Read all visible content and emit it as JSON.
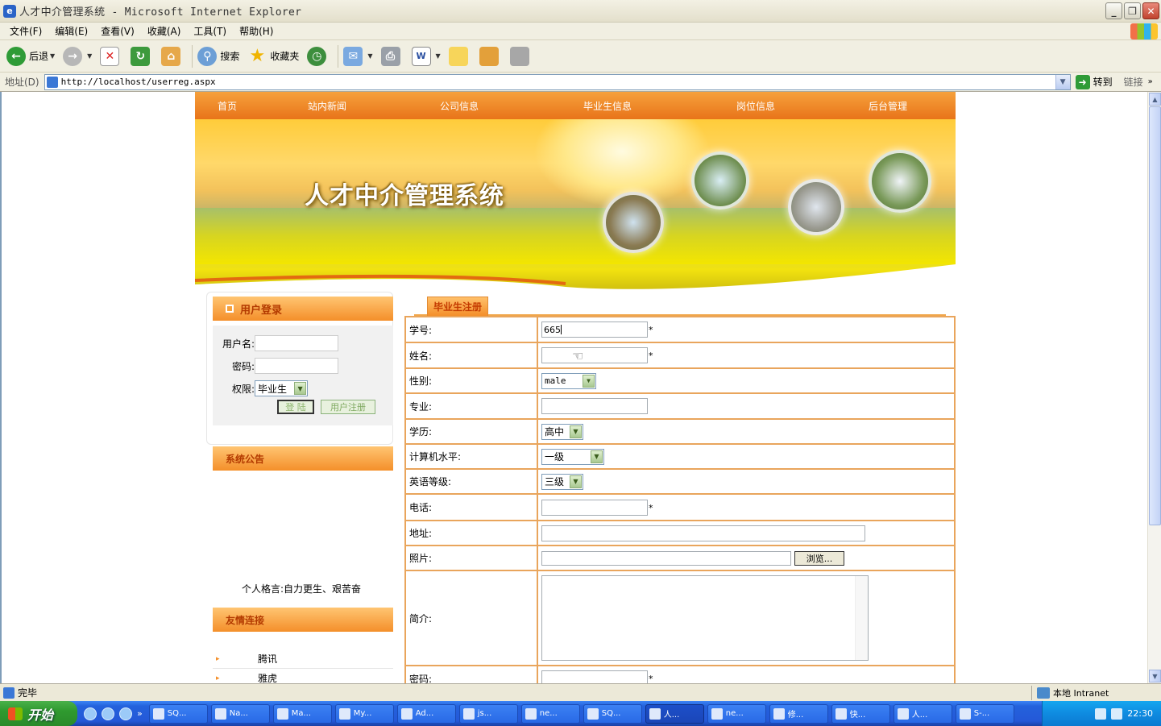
{
  "window": {
    "title": "人才中介管理系统 - Microsoft Internet Explorer"
  },
  "menu": [
    "文件(F)",
    "编辑(E)",
    "查看(V)",
    "收藏(A)",
    "工具(T)",
    "帮助(H)"
  ],
  "toolbar": {
    "back_label": "后退",
    "search_label": "搜索",
    "favorites_label": "收藏夹"
  },
  "address": {
    "label": "地址(D)",
    "url": "http://localhost/userreg.aspx",
    "go_label": "转到",
    "links_label": "链接"
  },
  "site": {
    "nav": [
      "首页",
      "站内新闻",
      "公司信息",
      "毕业生信息",
      "岗位信息",
      "后台管理"
    ],
    "banner_title": "人才中介管理系统"
  },
  "login": {
    "title": "用户登录",
    "username_label": "用户名:",
    "password_label": "密码:",
    "role_label": "权限:",
    "role_value": "毕业生",
    "login_button": "登 陆",
    "register_button": "用户注册"
  },
  "notice": {
    "title": "系统公告",
    "motto": "个人格言:自力更生、艰苦奋"
  },
  "friend_links": {
    "title": "友情连接",
    "items": [
      "腾讯",
      "雅虎"
    ]
  },
  "form": {
    "tab_label": "毕业生注册",
    "fields": {
      "student_id": {
        "label": "学号:",
        "value": "665"
      },
      "name": {
        "label": "姓名:"
      },
      "gender": {
        "label": "性别:",
        "value": "male"
      },
      "major": {
        "label": "专业:"
      },
      "education": {
        "label": "学历:",
        "value": "高中"
      },
      "computer_level": {
        "label": "计算机水平:",
        "value": "一级"
      },
      "english_level": {
        "label": "英语等级:",
        "value": "三级"
      },
      "phone": {
        "label": "电话:"
      },
      "address": {
        "label": "地址:"
      },
      "photo": {
        "label": "照片:",
        "browse_label": "浏览..."
      },
      "intro": {
        "label": "简介:"
      },
      "password": {
        "label": "密码:"
      }
    },
    "required_mark": "*"
  },
  "statusbar": {
    "status": "完毕",
    "zone": "本地 Intranet"
  },
  "taskbar": {
    "start_label": "开始",
    "tasks": [
      "SQ...",
      "Na...",
      "Ma...",
      "My...",
      "Ad...",
      "js...",
      "ne...",
      "SQ...",
      "人...",
      "ne...",
      "修...",
      "快...",
      "人...",
      "S-..."
    ],
    "active_task_index": 8,
    "clock": "22:30"
  }
}
